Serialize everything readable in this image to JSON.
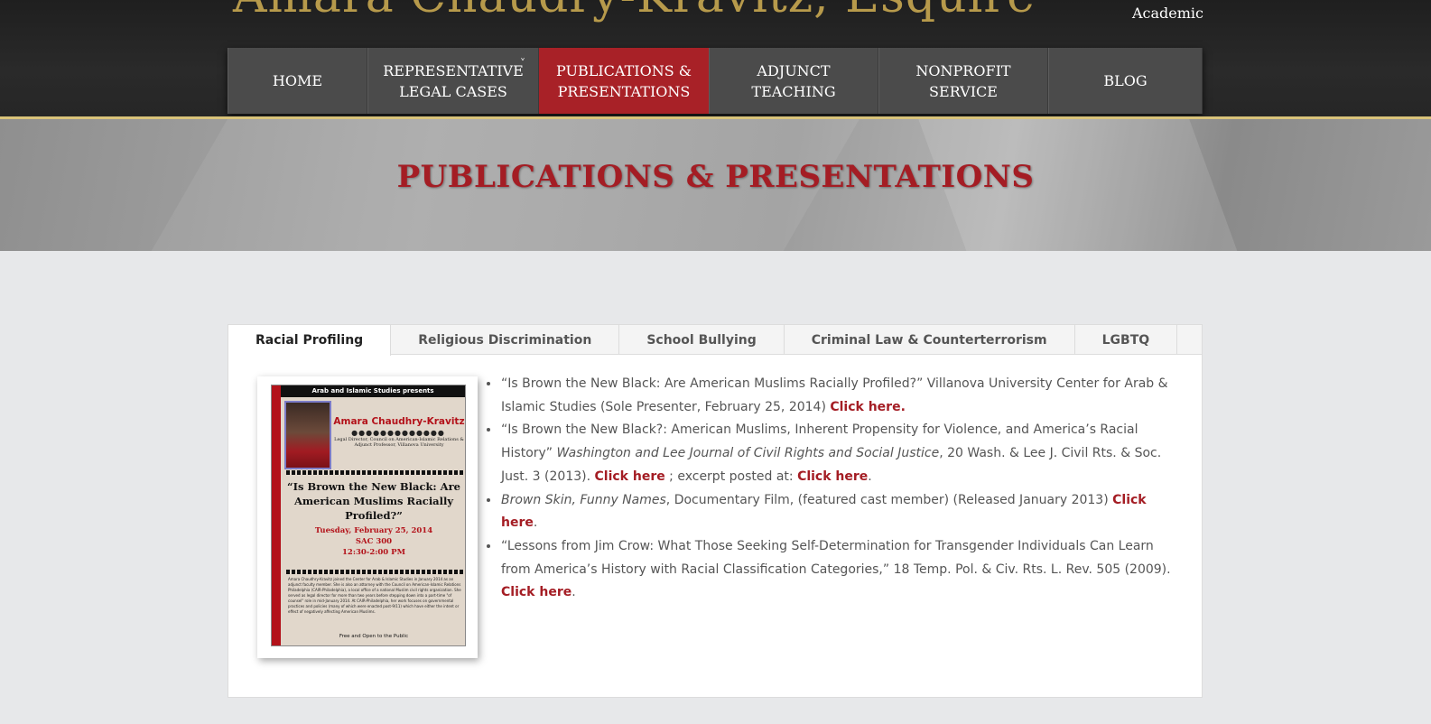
{
  "header": {
    "site_title": "Amara Chaudry-Kravitz, Esquire",
    "tagline": "Academic"
  },
  "nav": {
    "items": [
      {
        "line1": "HOME",
        "line2": ""
      },
      {
        "line1": "REPRESENTATIVE",
        "line2": "LEGAL CASES",
        "chevron": "˅"
      },
      {
        "line1": "PUBLICATIONS &",
        "line2": "PRESENTATIONS"
      },
      {
        "line1": "ADJUNCT",
        "line2": "TEACHING"
      },
      {
        "line1": "NONPROFIT",
        "line2": "SERVICE"
      },
      {
        "line1": "BLOG",
        "line2": ""
      }
    ],
    "active_index": 2
  },
  "banner": {
    "title": "PUBLICATIONS & PRESENTATIONS"
  },
  "tabs": [
    "Racial Profiling",
    "Religious Discrimination",
    "School Bullying",
    "Criminal Law & Counterterrorism",
    "LGBTQ"
  ],
  "poster": {
    "top_banner": "Arab and Islamic Studies presents",
    "name": "Amara Chaudhry-Kravitz",
    "dots": "●●●●●●●●●●●●●",
    "role": "Legal Director, Council on American-Islamic Relations & Adjunct Professor, Villanova University",
    "headline": "“Is Brown the New Black: Are American Muslims Racially Profiled?”",
    "date": "Tuesday, February 25, 2014",
    "room": "SAC 300",
    "time": "12:30-2:00 PM",
    "blurb": "Amara Chaudhry-Kravitz joined the Center for Arab & Islamic Studies in January 2014 as an adjunct faculty member. She is also an attorney with the Council on American-Islamic Relations Philadelphia (CAIR-Philadelphia), a local office of a national Muslim civil rights organization. She served as legal director for more than two years before stepping down into a part-time \"of counsel\" role in mid-January 2014. At CAIR-Philadelphia, her work focuses on governmental practices and policies (many of which were enacted post-9/11) which have either the intent or effect of negatively affecting American Muslims.",
    "footer": "Free and Open to the Public"
  },
  "publications": [
    {
      "text1": "“Is Brown the New Black: Are American Muslims Racially Profiled?” Villanova University Center for Arab & Islamic Studies (Sole Presenter, February 25, 2014) ",
      "link1": "Click here."
    },
    {
      "text1": "“Is Brown the New Black?: American Muslims, Inherent Propensity for Violence, and America’s Racial History” ",
      "italic": "Washington and Lee Journal of Civil Rights and Social Justice",
      "text2": ", 20 Wash. & Lee J. Civil Rts. & Soc. Just. 3 (2013). ",
      "link1": "Click here",
      "text3": " ; excerpt posted at: ",
      "link2": "Click here",
      "text4": "."
    },
    {
      "italic": "Brown Skin, Funny Names",
      "text1": ", Documentary Film, (featured cast member) (Released January 2013) ",
      "link1": "Click here",
      "text2": "."
    },
    {
      "text1": "“Lessons from Jim Crow: What Those Seeking Self-Determination for Transgender Individuals Can Learn from America’s History with Racial Classification Categories,” 18 Temp. Pol. & Civ. Rts. L. Rev. 505 (2009). ",
      "link1": "Click here",
      "text2": "."
    }
  ],
  "colors": {
    "accent": "#a82127",
    "nav_bg": "#4b4b4b",
    "gold": "#b79a4b"
  }
}
